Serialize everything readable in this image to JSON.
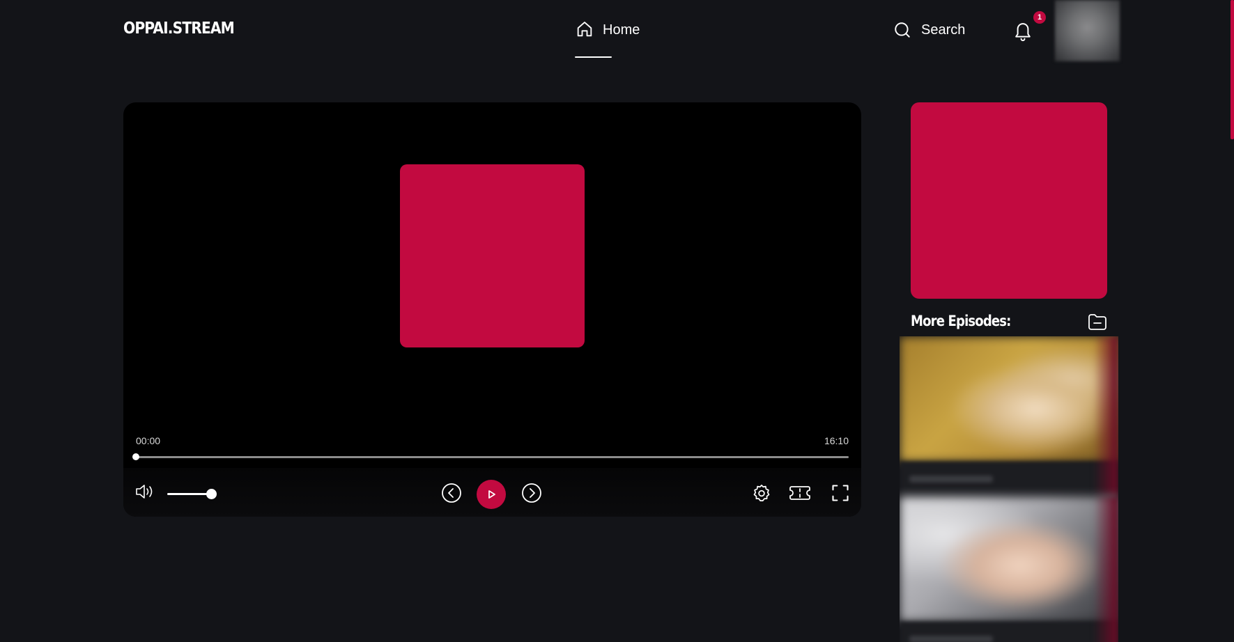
{
  "header": {
    "logo": "OPPAI.STREAM",
    "nav": {
      "home_label": "Home",
      "home_icon": "home-icon"
    },
    "search_label": "Search",
    "search_icon": "search-icon",
    "notifications": {
      "icon": "bell-icon",
      "count": "1"
    },
    "avatar_icon": "avatar"
  },
  "player": {
    "current_time": "00:00",
    "duration": "16:10",
    "progress": 0,
    "volume": 1.0,
    "icons": {
      "volume": "volume-icon",
      "previous": "chevron-left-icon",
      "play": "play-icon",
      "next": "chevron-right-icon",
      "settings": "gear-icon",
      "theater": "theater-mode-icon",
      "fullscreen": "fullscreen-icon"
    }
  },
  "sidebar": {
    "more_episodes_title": "More Episodes:",
    "folder_icon": "folder-minus-icon",
    "episodes": [
      {
        "thumbnail": "episode-thumbnail"
      },
      {
        "thumbnail": "episode-thumbnail"
      }
    ]
  },
  "colors": {
    "background": "#131418",
    "accent": "#c20a40",
    "player_bg": "#000000",
    "text": "#ffffff"
  }
}
